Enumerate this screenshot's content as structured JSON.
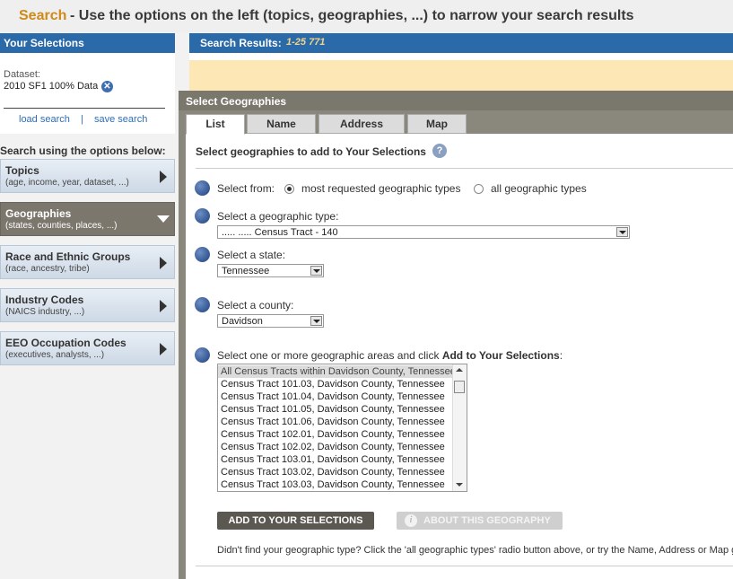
{
  "header": {
    "search_word": "Search",
    "instruction": "- Use the options on the left (topics, geographies, ...) to narrow your search results"
  },
  "selections": {
    "title": "Your Selections",
    "dataset_label": "Dataset:",
    "dataset_value": "2010 SF1 100% Data",
    "load_search": "load search",
    "separator": "|",
    "save_search": "save search"
  },
  "options_label": "Search using the options below:",
  "categories": [
    {
      "title": "Topics",
      "subtitle": "(age, income, year, dataset, ...)"
    },
    {
      "title": "Geographies",
      "subtitle": "(states, counties, places, ...)"
    },
    {
      "title": "Race and Ethnic Groups",
      "subtitle": "(race, ancestry, tribe)"
    },
    {
      "title": "Industry Codes",
      "subtitle": "(NAICS industry, ...)"
    },
    {
      "title": "EEO Occupation Codes",
      "subtitle": "(executives, analysts, ...)"
    }
  ],
  "results": {
    "title": "Search Results:",
    "count": "1-25 771"
  },
  "dialog": {
    "title": "Select Geographies",
    "tabs": [
      "List",
      "Name",
      "Address",
      "Map"
    ],
    "intro": "Select geographies to add to Your Selections",
    "help": "?",
    "select_from": "Select from:",
    "radio_most": "most requested geographic types",
    "radio_all": "all geographic types",
    "geo_type_label": "Select a geographic type:",
    "geo_type_value": "..... ..... Census Tract - 140",
    "state_label": "Select a state:",
    "state_value": "Tennessee",
    "county_label": "Select a county:",
    "county_value": "Davidson",
    "areas_label_pre": "Select one or more geographic areas and click ",
    "areas_label_bold": "Add to Your Selections",
    "areas_label_post": ":",
    "areas": [
      "All Census Tracts within Davidson County, Tennessee",
      "Census Tract 101.03, Davidson County, Tennessee",
      "Census Tract 101.04, Davidson County, Tennessee",
      "Census Tract 101.05, Davidson County, Tennessee",
      "Census Tract 101.06, Davidson County, Tennessee",
      "Census Tract 102.01, Davidson County, Tennessee",
      "Census Tract 102.02, Davidson County, Tennessee",
      "Census Tract 103.01, Davidson County, Tennessee",
      "Census Tract 103.02, Davidson County, Tennessee",
      "Census Tract 103.03, Davidson County, Tennessee"
    ],
    "add_button": "ADD TO YOUR SELECTIONS",
    "about_button": "ABOUT THIS GEOGRAPHY",
    "about_icon": "i",
    "note": "Didn't find your geographic type? Click the 'all geographic types' radio button above, or try the Name, Address or Map g"
  },
  "colors": {
    "brand_blue": "#2b6aa8",
    "accent_orange": "#d08a18",
    "dialog_gray": "#7a776d",
    "results_tan": "#fde8b5"
  },
  "icons": {
    "remove": "remove-circle-icon",
    "help": "help-circle-icon",
    "info": "info-icon"
  }
}
